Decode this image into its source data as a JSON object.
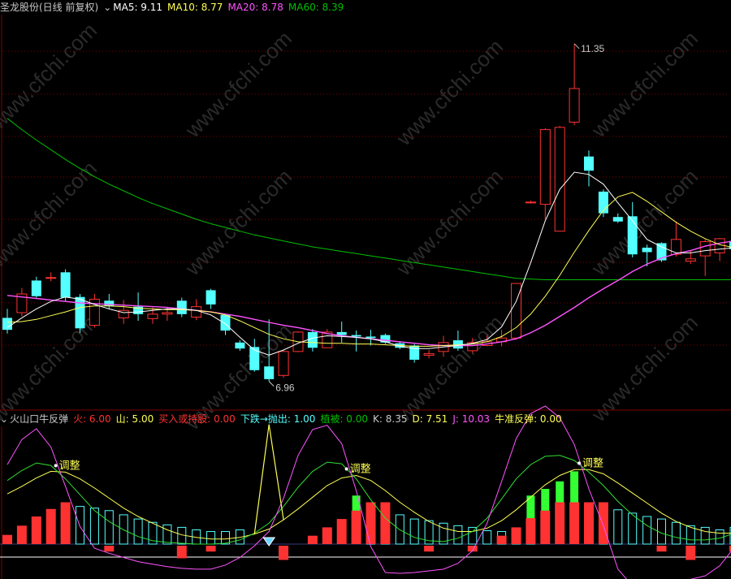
{
  "header": {
    "stock_title": "圣龙股份(日线 前复权)",
    "ma5": "MA5: 9.11",
    "ma10": "MA10: 8.77",
    "ma20": "MA20: 8.78",
    "ma60": "MA60: 8.39"
  },
  "indicator_header": {
    "name": "火山口牛反弹",
    "huo": "火: 6.00",
    "shan": "山: 5.00",
    "buy_hold": "买入或持股: 0.00",
    "down_sell": "下跌→抛出: 1.00",
    "zhibei": "植被: 0.00",
    "k": "K: 8.35",
    "d": "D: 7.51",
    "j": "J: 10.03",
    "bull_rebound": "牛准反弹: 0.00"
  },
  "colors": {
    "up": "#ff3232",
    "down": "#54ffff",
    "ma5": "#ffffff",
    "ma10": "#ffff54",
    "ma20": "#ff54ff",
    "ma60": "#00c000",
    "grid": "#800000"
  },
  "watermark": "www.cfchi.com",
  "chart_data": [
    {
      "type": "candlestick",
      "high_label": "11.35",
      "low_label": "6.96",
      "candles": [
        {
          "o": 7.68,
          "c": 7.52,
          "h": 7.8,
          "l": 7.47
        },
        {
          "o": 7.75,
          "c": 8.0,
          "h": 8.08,
          "l": 7.7
        },
        {
          "o": 8.18,
          "c": 7.97,
          "h": 8.23,
          "l": 7.95
        },
        {
          "o": 8.22,
          "c": 8.22,
          "h": 8.29,
          "l": 8.17
        },
        {
          "o": 8.29,
          "c": 7.95,
          "h": 8.33,
          "l": 7.9
        },
        {
          "o": 7.96,
          "c": 7.54,
          "h": 8.0,
          "l": 7.48
        },
        {
          "o": 7.58,
          "c": 7.93,
          "h": 8.0,
          "l": 7.55
        },
        {
          "o": 7.91,
          "c": 7.84,
          "h": 8.0,
          "l": 7.8
        },
        {
          "o": 7.68,
          "c": 7.78,
          "h": 7.92,
          "l": 7.6
        },
        {
          "o": 7.83,
          "c": 7.73,
          "h": 8.02,
          "l": 7.64
        },
        {
          "o": 7.67,
          "c": 7.73,
          "h": 7.82,
          "l": 7.6
        },
        {
          "o": 7.73,
          "c": 7.75,
          "h": 7.83,
          "l": 7.64
        },
        {
          "o": 7.91,
          "c": 7.73,
          "h": 7.95,
          "l": 7.69
        },
        {
          "o": 7.69,
          "c": 7.83,
          "h": 7.93,
          "l": 7.65
        },
        {
          "o": 8.05,
          "c": 7.86,
          "h": 8.07,
          "l": 7.8
        },
        {
          "o": 7.72,
          "c": 7.51,
          "h": 7.73,
          "l": 7.45
        },
        {
          "o": 7.35,
          "c": 7.27,
          "h": 7.38,
          "l": 7.24
        },
        {
          "o": 7.29,
          "c": 6.98,
          "h": 7.4,
          "l": 6.96
        },
        {
          "o": 7.03,
          "c": 6.86,
          "h": 7.66,
          "l": 6.83
        },
        {
          "o": 6.91,
          "c": 7.23,
          "h": 7.25,
          "l": 6.88
        },
        {
          "o": 7.23,
          "c": 7.49,
          "h": 7.5,
          "l": 7.22
        },
        {
          "o": 7.49,
          "c": 7.28,
          "h": 7.53,
          "l": 7.23
        },
        {
          "o": 7.28,
          "c": 7.49,
          "h": 7.53,
          "l": 7.28
        },
        {
          "o": 7.49,
          "c": 7.45,
          "h": 7.63,
          "l": 7.35
        },
        {
          "o": 7.45,
          "c": 7.43,
          "h": 7.51,
          "l": 7.23
        },
        {
          "o": 7.43,
          "c": 7.41,
          "h": 7.52,
          "l": 7.31
        },
        {
          "o": 7.45,
          "c": 7.35,
          "h": 7.47,
          "l": 7.33
        },
        {
          "o": 7.34,
          "c": 7.28,
          "h": 7.37,
          "l": 7.26
        },
        {
          "o": 7.31,
          "c": 7.12,
          "h": 7.33,
          "l": 7.08
        },
        {
          "o": 7.18,
          "c": 7.2,
          "h": 7.25,
          "l": 7.14
        },
        {
          "o": 7.23,
          "c": 7.35,
          "h": 7.44,
          "l": 7.16
        },
        {
          "o": 7.38,
          "c": 7.27,
          "h": 7.51,
          "l": 7.24
        },
        {
          "o": 7.24,
          "c": 7.35,
          "h": 7.41,
          "l": 7.21
        },
        {
          "o": 7.31,
          "c": 7.36,
          "h": 7.45,
          "l": 7.3
        },
        {
          "o": 7.36,
          "c": 7.41,
          "h": 7.52,
          "l": 7.3
        },
        {
          "o": 7.41,
          "c": 8.14,
          "h": 8.14,
          "l": 7.39
        },
        {
          "o": 9.23,
          "c": 9.23,
          "h": 9.25,
          "l": 9.21
        },
        {
          "o": 9.2,
          "c": 10.2,
          "h": 10.22,
          "l": 9.0
        },
        {
          "o": 8.84,
          "c": 10.23,
          "h": 10.25,
          "l": 8.84
        },
        {
          "o": 10.3,
          "c": 10.75,
          "h": 11.35,
          "l": 10.26
        },
        {
          "o": 9.84,
          "c": 9.65,
          "h": 9.92,
          "l": 9.44
        },
        {
          "o": 9.37,
          "c": 9.08,
          "h": 9.4,
          "l": 9.03
        },
        {
          "o": 9.03,
          "c": 8.97,
          "h": 9.08,
          "l": 8.95
        },
        {
          "o": 9.04,
          "c": 8.53,
          "h": 9.23,
          "l": 8.49
        },
        {
          "o": 8.62,
          "c": 8.56,
          "h": 8.66,
          "l": 8.37
        },
        {
          "o": 8.68,
          "c": 8.45,
          "h": 8.69,
          "l": 8.43
        },
        {
          "o": 8.53,
          "c": 8.73,
          "h": 8.97,
          "l": 8.5
        },
        {
          "o": 8.44,
          "c": 8.47,
          "h": 8.59,
          "l": 8.4
        },
        {
          "o": 8.51,
          "c": 8.7,
          "h": 8.73,
          "l": 8.24
        },
        {
          "o": 8.55,
          "c": 8.74,
          "h": 8.75,
          "l": 8.44
        },
        {
          "o": 8.71,
          "c": 8.6,
          "h": 8.73,
          "l": 8.45
        },
        {
          "o": 8.55,
          "c": 8.7,
          "h": 9.13,
          "l": 8.47
        }
      ],
      "ma5": [
        7.55,
        7.68,
        7.8,
        7.9,
        7.96,
        7.93,
        7.86,
        7.8,
        7.75,
        7.76,
        7.78,
        7.8,
        7.8,
        7.78,
        7.72,
        7.6,
        7.42,
        7.25,
        7.18,
        7.25,
        7.34,
        7.41,
        7.44,
        7.43,
        7.42,
        7.4,
        7.36,
        7.3,
        7.27,
        7.27,
        7.29,
        7.31,
        7.34,
        7.39,
        7.56,
        7.9,
        8.42,
        8.98,
        9.4,
        9.63,
        9.6,
        9.47,
        9.22,
        8.98,
        8.73,
        8.63,
        8.55,
        8.55,
        8.58,
        8.6,
        8.62,
        8.7
      ],
      "ma10": [
        7.62,
        7.63,
        7.66,
        7.71,
        7.76,
        7.82,
        7.84,
        7.84,
        7.83,
        7.81,
        7.8,
        7.79,
        7.79,
        7.78,
        7.76,
        7.72,
        7.64,
        7.55,
        7.46,
        7.4,
        7.36,
        7.35,
        7.34,
        7.34,
        7.33,
        7.33,
        7.32,
        7.31,
        7.3,
        7.3,
        7.31,
        7.32,
        7.33,
        7.36,
        7.43,
        7.55,
        7.73,
        7.97,
        8.25,
        8.56,
        8.85,
        9.12,
        9.3,
        9.36,
        9.24,
        9.1,
        8.96,
        8.84,
        8.74,
        8.66,
        8.62,
        8.65
      ],
      "ma20": [
        7.98,
        7.96,
        7.94,
        7.92,
        7.9,
        7.88,
        7.87,
        7.86,
        7.85,
        7.84,
        7.83,
        7.82,
        7.8,
        7.78,
        7.76,
        7.73,
        7.7,
        7.66,
        7.62,
        7.58,
        7.55,
        7.51,
        7.47,
        7.44,
        7.42,
        7.4,
        7.38,
        7.36,
        7.34,
        7.32,
        7.31,
        7.31,
        7.31,
        7.33,
        7.36,
        7.4,
        7.48,
        7.58,
        7.7,
        7.82,
        7.95,
        8.07,
        8.18,
        8.3,
        8.4,
        8.48,
        8.54,
        8.58,
        8.64,
        8.68,
        8.71,
        8.76
      ],
      "ma60": [
        10.35,
        10.2,
        10.06,
        9.93,
        9.8,
        9.68,
        9.57,
        9.47,
        9.38,
        9.29,
        9.21,
        9.14,
        9.07,
        9.0,
        8.94,
        8.89,
        8.84,
        8.79,
        8.75,
        8.71,
        8.67,
        8.63,
        8.6,
        8.57,
        8.54,
        8.51,
        8.48,
        8.45,
        8.42,
        8.39,
        8.36,
        8.33,
        8.3,
        8.27,
        8.24,
        8.21,
        8.2,
        8.19,
        8.19,
        8.19,
        8.19,
        8.19,
        8.19,
        8.19,
        8.19,
        8.19,
        8.19,
        8.19,
        8.19,
        8.19,
        8.19,
        8.2
      ]
    },
    {
      "type": "bar",
      "annotations": [
        {
          "text": "调整",
          "index": 4
        },
        {
          "text": "调整",
          "index": 24
        },
        {
          "text": "调整",
          "index": 40
        }
      ],
      "red_bars": [
        1.1,
        2.2,
        3.3,
        4.2,
        5.0,
        0,
        0,
        -0.7,
        0,
        0,
        0,
        0,
        -1.5,
        0,
        -0.7,
        0,
        0,
        0,
        0,
        -1.7,
        0,
        1.0,
        2.0,
        3.0,
        4.0,
        5.0,
        5.0,
        0,
        0,
        -0.7,
        0,
        0,
        -0.7,
        0,
        1.0,
        2.0,
        3.1,
        4.0,
        5.0,
        5.0,
        5.0,
        5.0,
        0,
        0,
        0,
        -0.7,
        0,
        -1.7,
        0,
        0,
        -0.7,
        -0.7
      ],
      "green_bars": [
        0,
        0,
        0,
        0,
        0,
        0,
        0,
        0,
        0,
        0,
        0,
        0,
        0,
        0,
        0,
        0,
        0,
        0,
        0,
        0,
        0,
        0,
        0,
        0,
        5.8,
        0,
        0,
        0,
        0,
        0,
        0,
        0,
        0,
        0,
        0,
        0,
        5.8,
        6.6,
        7.5,
        8.7,
        0,
        0,
        0,
        0,
        0,
        0,
        0,
        0,
        0,
        0,
        0,
        0
      ],
      "cyan_bars": [
        0,
        0,
        0,
        0,
        0,
        4.5,
        4.3,
        4.0,
        3.5,
        3.0,
        2.6,
        2.3,
        2.0,
        1.7,
        1.5,
        1.5,
        1.7,
        0,
        0,
        0,
        0,
        0,
        0,
        0,
        0,
        4.5,
        4.0,
        3.5,
        3.0,
        2.8,
        2.5,
        2.2,
        2.0,
        1.6,
        1.5,
        1.5,
        1.5,
        0,
        0,
        0,
        0,
        4.5,
        4.1,
        3.7,
        3.3,
        3.0,
        2.6,
        2.2,
        2.0,
        1.7,
        2.0,
        2.4
      ],
      "k": [
        7.6,
        8.8,
        9.7,
        9.4,
        7.8,
        5.9,
        4.0,
        2.7,
        1.7,
        0.9,
        0.4,
        0.2,
        0.1,
        0.0,
        0.0,
        0.1,
        0.5,
        1.3,
        2.5,
        4.5,
        6.8,
        8.7,
        9.8,
        9.6,
        7.8,
        5.3,
        3.1,
        1.7,
        0.8,
        0.4,
        0.3,
        0.7,
        1.5,
        3.1,
        5.4,
        7.8,
        9.5,
        10.5,
        10.6,
        10.0,
        8.6,
        7.0,
        5.1,
        3.5,
        2.2,
        1.3,
        0.8,
        0.5,
        0.5,
        0.7,
        1.3,
        2.8
      ],
      "d": [
        6.0,
        6.9,
        7.9,
        8.7,
        8.6,
        7.8,
        6.7,
        5.5,
        4.3,
        3.3,
        2.5,
        1.7,
        1.1,
        0.8,
        0.6,
        0.6,
        0.8,
        1.2,
        1.8,
        2.9,
        4.2,
        5.6,
        7.0,
        7.9,
        8.2,
        7.6,
        6.4,
        5.0,
        3.8,
        2.7,
        1.9,
        1.5,
        1.5,
        1.9,
        2.8,
        4.1,
        5.6,
        7.1,
        8.2,
        8.9,
        8.9,
        8.4,
        7.3,
        6.1,
        4.9,
        3.7,
        2.7,
        2.0,
        1.5,
        1.3,
        1.3,
        1.8
      ],
      "j": [
        9.5,
        12.5,
        13.8,
        11.6,
        6.9,
        2.1,
        -0.5,
        -1.1,
        -1.6,
        -2.1,
        -2.4,
        -2.7,
        -2.9,
        -3.0,
        -3.0,
        -2.5,
        -1.6,
        -0.2,
        1.5,
        5.5,
        10.6,
        13.7,
        14.2,
        12.0,
        6.4,
        -0.3,
        -3.4,
        -3.5,
        -3.4,
        -3.2,
        -3.0,
        -2.3,
        -0.8,
        2.5,
        7.5,
        12.6,
        15.6,
        16.5,
        15.1,
        11.9,
        6.6,
        2.2,
        -3.0,
        -5.0,
        -5.3,
        -5.0,
        -4.6,
        -4.2,
        -3.8,
        -2.6,
        -0.4,
        4.3
      ],
      "j_spike": {
        "index": 18,
        "value": 14.3
      }
    }
  ]
}
